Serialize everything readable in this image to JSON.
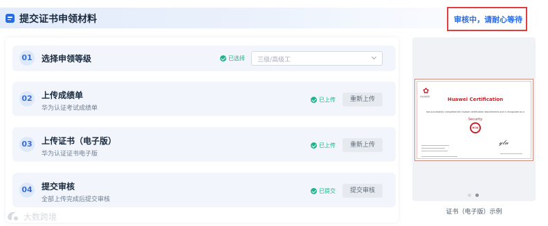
{
  "header": {
    "title": "提交证书申领材料",
    "status": "审核中，请耐心等待",
    "status_border_color": "#e03c3c",
    "accent": "#2a6be0"
  },
  "steps": [
    {
      "number": "01",
      "title": "选择申领等级",
      "status": "已选择",
      "select_value": "三级/高级工"
    },
    {
      "number": "02",
      "title": "上传成绩单",
      "subtitle": "华为认证考试成绩单",
      "status": "已上传",
      "button": "重新上传"
    },
    {
      "number": "03",
      "title": "上传证书（电子版）",
      "subtitle": "华为认证证书电子版",
      "status": "已上传",
      "button": "重新上传"
    },
    {
      "number": "04",
      "title": "提交审核",
      "subtitle": "全部上传完成后提交审核",
      "status": "已提交",
      "button": "提交审核"
    }
  ],
  "preview": {
    "caption": "证书（电子版）示例",
    "certificate": {
      "logo": "HUAWEI",
      "title": "Huawei Certification",
      "body": "has successfully completed the Huawei certification requirements and is recognized as a",
      "track": "Security",
      "seal": "HCIA"
    },
    "carousel_dots": 2,
    "active_dot": 2
  },
  "watermark": {
    "text": "大数跨境"
  },
  "colors": {
    "success": "#1fb38a",
    "step_bg": "#f2f6fc"
  }
}
